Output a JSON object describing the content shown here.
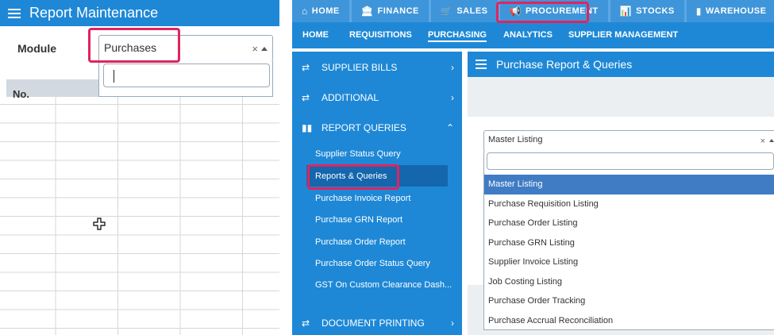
{
  "left": {
    "header_title": "Report Maintenance",
    "module_label": "Module",
    "module_value": "Purchases",
    "clear_glyph": "×",
    "table_first_header": "No."
  },
  "top_nav": {
    "items": [
      {
        "icon": "⌂",
        "label": "HOME"
      },
      {
        "icon": "🏛",
        "label": "FINANCE"
      },
      {
        "icon": "🛒",
        "label": "SALES"
      },
      {
        "icon": "📢",
        "label": "PROCUREMENT"
      },
      {
        "icon": "📊",
        "label": "STOCKS"
      },
      {
        "icon": "▮",
        "label": "WAREHOUSE"
      },
      {
        "icon": "▯",
        "label": ""
      }
    ]
  },
  "sub_nav": {
    "items": [
      "HOME",
      "REQUISITIONS",
      "PURCHASING",
      "ANALYTICS",
      "SUPPLIER MANAGEMENT"
    ],
    "active": "PURCHASING"
  },
  "sidebar": {
    "groups": {
      "supplier_bills": "SUPPLIER BILLS",
      "additional": "ADDITIONAL",
      "report_queries": "REPORT QUERIES",
      "document_printing": "DOCUMENT PRINTING"
    },
    "links": [
      "Supplier Status Query",
      "Reports & Queries",
      "Purchase Invoice Report",
      "Purchase GRN Report",
      "Purchase Order Report",
      "Purchase Order Status Query",
      "GST On Custom Clearance Dash..."
    ],
    "selected_link": "Reports & Queries"
  },
  "main": {
    "title": "Purchase Report & Queries",
    "select_value": "Master Listing",
    "clear_glyph": "×",
    "options": [
      "Master Listing",
      "Purchase Requisition Listing",
      "Purchase Order Listing",
      "Purchase GRN Listing",
      "Supplier Invoice Listing",
      "Job Costing Listing",
      "Purchase Order Tracking",
      "Purchase Accrual Reconciliation"
    ],
    "selected_option": "Master Listing"
  },
  "colors": {
    "primary_blue": "#1e88d6",
    "highlight_pink": "#e0245e",
    "selected_option": "#3f7cc4"
  },
  "icons": {
    "menu": "hamburger-icon",
    "sidebar_toggle": "arrows-exchange-icon",
    "report_queries": "bar-chart-icon",
    "expand": "chevron-right-icon",
    "collapse": "chevron-up-icon",
    "cursor": "move-cursor-icon"
  }
}
